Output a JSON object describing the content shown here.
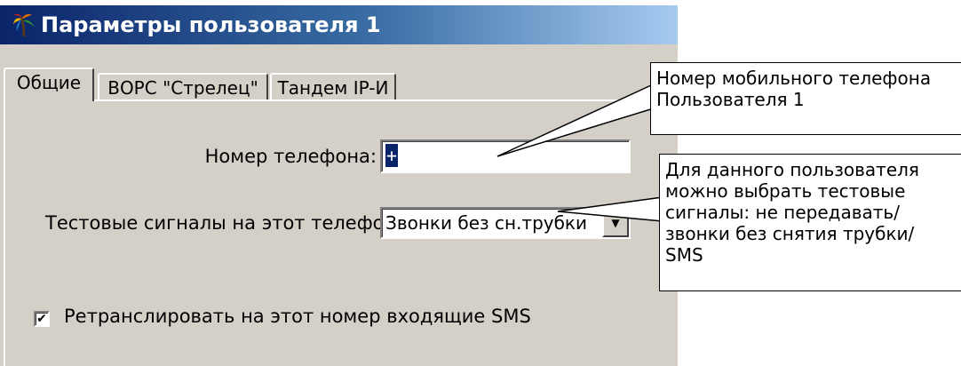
{
  "window": {
    "title": "Параметры пользователя 1",
    "icon": "app-icon"
  },
  "tabs": [
    {
      "label": "Общие",
      "active": true
    },
    {
      "label": "ВОРС \"Стрелец\"",
      "active": false
    },
    {
      "label": "Тандем IP-И",
      "active": false
    }
  ],
  "form": {
    "phone_label": "Номер телефона:",
    "phone_value": "+",
    "test_label": "Тестовые  сигналы на этот телефон:",
    "test_value": "Звонки без сн.трубки",
    "sms_label": "Ретранслировать на этот номер  входящие SMS",
    "sms_checked": true
  },
  "callouts": {
    "phone_note_line1": "Номер мобильного телефона",
    "phone_note_line2": "Пользователя 1",
    "test_note_line1": "Для данного пользователя",
    "test_note_line2": "можно выбрать тестовые",
    "test_note_line3": "сигналы: не передавать/",
    "test_note_line4": "звонки без снятия трубки/",
    "test_note_line5": "SMS"
  }
}
